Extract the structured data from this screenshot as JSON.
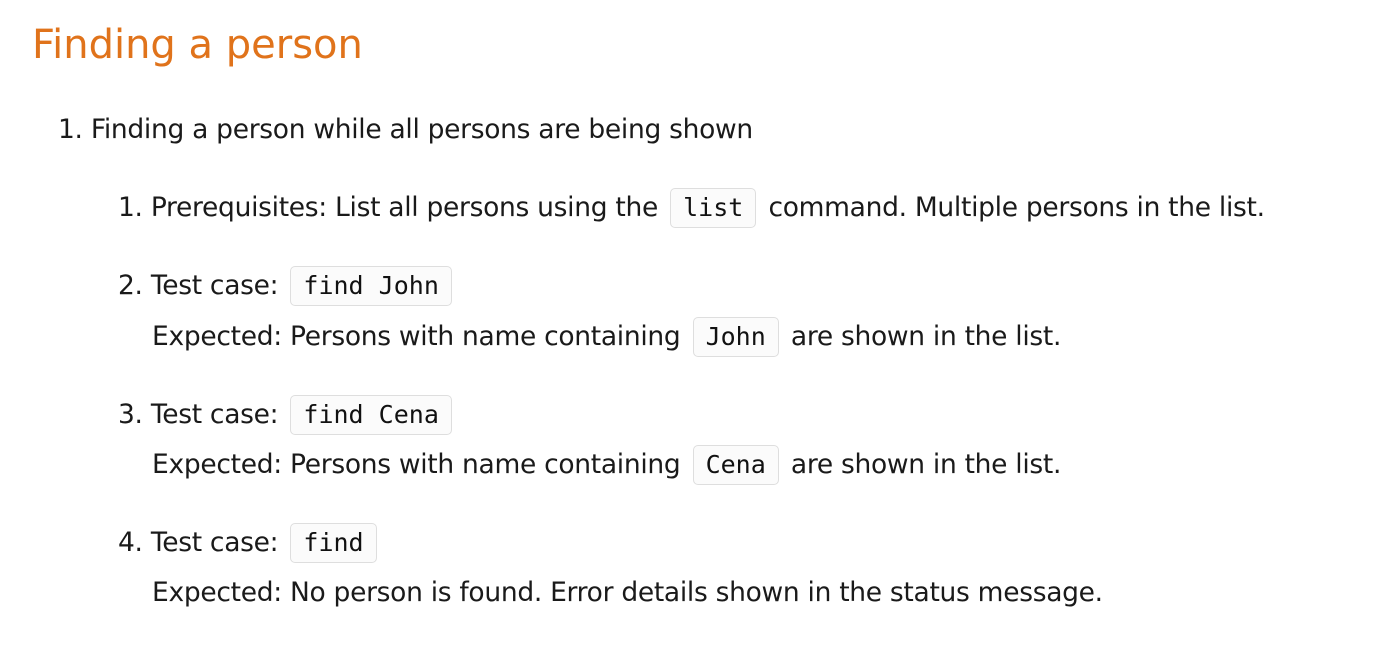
{
  "heading": "Finding a person",
  "item1": {
    "number": "1.",
    "text": "Finding a person while all persons are being shown"
  },
  "steps": [
    {
      "number": "1.",
      "prefix": "Prerequisites: List all persons using the",
      "code": "list",
      "suffix": "command. Multiple persons in the list."
    },
    {
      "number": "2.",
      "label": "Test case:",
      "command": "find John",
      "expected_prefix": "Expected: Persons with name containing",
      "expected_code": "John",
      "expected_suffix": "are shown in the list."
    },
    {
      "number": "3.",
      "label": "Test case:",
      "command": "find Cena",
      "expected_prefix": "Expected: Persons with name containing",
      "expected_code": "Cena",
      "expected_suffix": "are shown in the list."
    },
    {
      "number": "4.",
      "label": "Test case:",
      "command": "find",
      "expected": "Expected: No person is found. Error details shown in the status message."
    }
  ],
  "colors": {
    "heading": "#e0731b",
    "text": "#1a1a1a",
    "code_border": "#dedede",
    "code_background": "#fbfbfb"
  }
}
